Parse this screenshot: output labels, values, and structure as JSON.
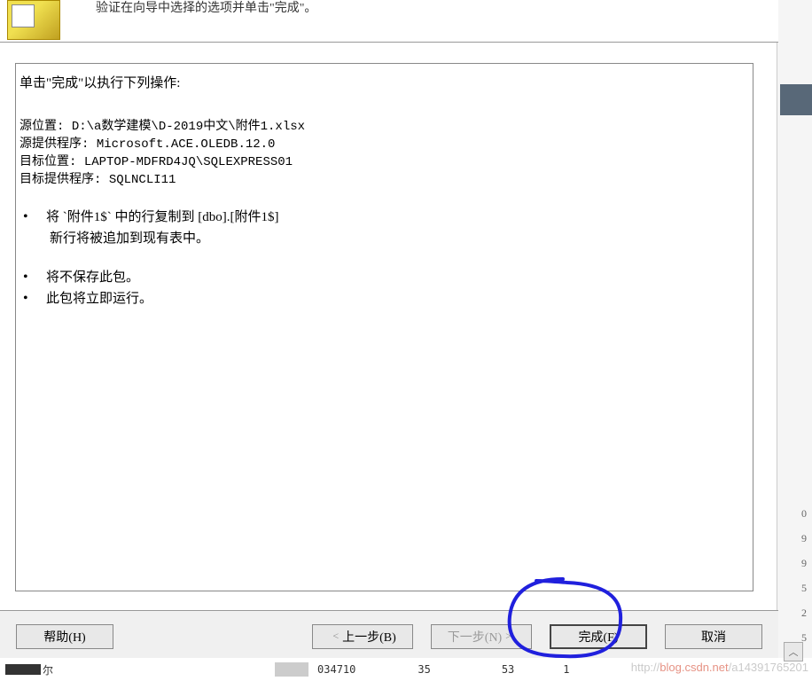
{
  "header": {
    "subtitle": "验证在向导中选择的选项并单击\"完成\"。"
  },
  "content": {
    "title": "单击\"完成\"以执行下列操作:",
    "source_location_label": "源位置:",
    "source_location_value": "D:\\a数学建模\\D-2019中文\\附件1.xlsx",
    "source_provider_label": "源提供程序:",
    "source_provider_value": "Microsoft.ACE.OLEDB.12.0",
    "target_location_label": "目标位置:",
    "target_location_value": "LAPTOP-MDFRD4JQ\\SQLEXPRESS01",
    "target_provider_label": "目标提供程序:",
    "target_provider_value": "SQLNCLI11",
    "bullet1_line1": "将 `附件1$` 中的行复制到 [dbo].[附件1$]",
    "bullet1_line2": "新行将被追加到现有表中。",
    "bullet2": "将不保存此包。",
    "bullet3": "此包将立即运行。"
  },
  "buttons": {
    "help": "帮助(H)",
    "back": "上一步(B)",
    "next": "下一步(N)",
    "finish": "完成(F)",
    "cancel": "取消"
  },
  "strip": {
    "t1": "尔",
    "n1": "034710",
    "n2": "35",
    "n3": "53",
    "n4": "1"
  },
  "side": {
    "r1": "0",
    "r2": "9",
    "r3": "9",
    "r4": "5",
    "r5": "2",
    "r6": "5"
  },
  "watermark": {
    "pre": "http://",
    "mid": "blog.csdn.net",
    "post": "/a14391765201"
  }
}
